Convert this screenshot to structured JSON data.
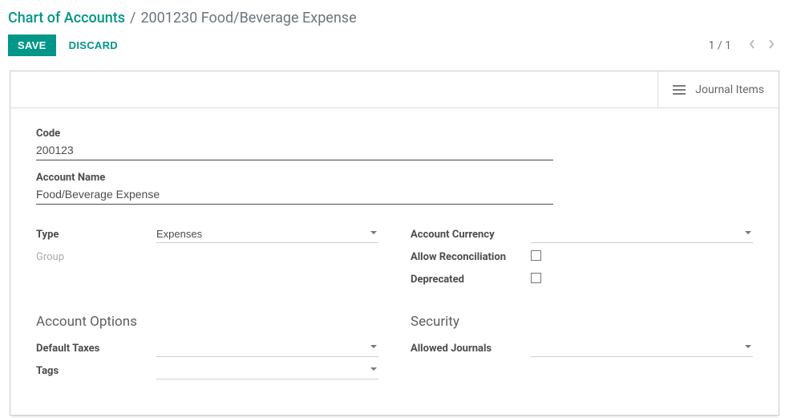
{
  "breadcrumb": {
    "root": "Chart of Accounts",
    "current": "2001230 Food/Beverage Expense"
  },
  "toolbar": {
    "save": "SAVE",
    "discard": "DISCARD"
  },
  "pager": {
    "text": "1 / 1"
  },
  "buttonbox": {
    "journal_items": "Journal Items"
  },
  "fields": {
    "code_label": "Code",
    "code_value": "200123",
    "name_label": "Account Name",
    "name_value": "Food/Beverage Expense",
    "type_label": "Type",
    "type_value": "Expenses",
    "group_label": "Group",
    "currency_label": "Account Currency",
    "currency_value": "",
    "reconcile_label": "Allow Reconciliation",
    "deprecated_label": "Deprecated"
  },
  "sections": {
    "account_options": "Account Options",
    "security": "Security",
    "default_taxes_label": "Default Taxes",
    "default_taxes_value": "",
    "tags_label": "Tags",
    "tags_value": "",
    "allowed_journals_label": "Allowed Journals",
    "allowed_journals_value": ""
  }
}
